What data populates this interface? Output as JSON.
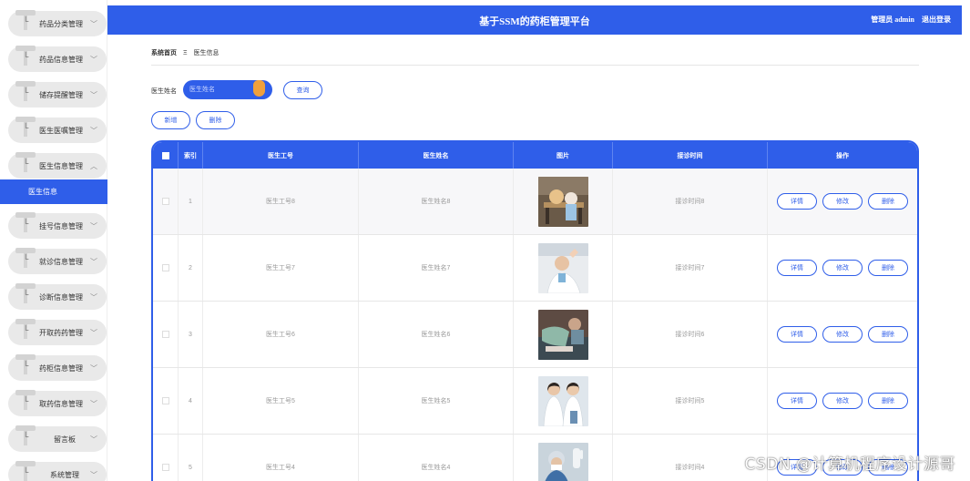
{
  "header": {
    "title": "基于SSM的药柜管理平台",
    "user_label": "管理员 admin",
    "logout": "退出登录"
  },
  "colors": {
    "primary": "#2f5ee9",
    "accent": "#f0a03c"
  },
  "sidebar": {
    "items": [
      {
        "label": "药品分类管理",
        "icon": "chevron-down-icon"
      },
      {
        "label": "药品信息管理",
        "icon": "chevron-down-icon"
      },
      {
        "label": "储存提醒管理",
        "icon": "chevron-down-icon"
      },
      {
        "label": "医生医嘱管理",
        "icon": "chevron-down-icon"
      },
      {
        "label": "医生信息管理",
        "icon": "chevron-up-icon"
      },
      {
        "label": "挂号信息管理",
        "icon": "chevron-down-icon"
      },
      {
        "label": "就诊信息管理",
        "icon": "chevron-down-icon"
      },
      {
        "label": "诊断信息管理",
        "icon": "chevron-down-icon"
      },
      {
        "label": "开取药药管理",
        "icon": "chevron-down-icon"
      },
      {
        "label": "药柜信息管理",
        "icon": "chevron-down-icon"
      },
      {
        "label": "取药信息管理",
        "icon": "chevron-down-icon"
      },
      {
        "label": "留言板",
        "icon": "chevron-down-icon"
      },
      {
        "label": "系统管理",
        "icon": "chevron-down-icon"
      }
    ],
    "active_sub": "医生信息"
  },
  "breadcrumb": {
    "home": "系统首页",
    "separator": "Ξ",
    "current": "医生信息"
  },
  "search": {
    "label": "医生姓名",
    "placeholder": "医生姓名",
    "query_button": "查询"
  },
  "actions": {
    "add": "新增",
    "delete": "删除"
  },
  "table": {
    "columns": [
      "索引",
      "医生工号",
      "医生姓名",
      "图片",
      "接诊时间",
      "操作"
    ],
    "rows": [
      {
        "index": "1",
        "id": "医生工号8",
        "name": "医生姓名8",
        "time": "接诊时间8"
      },
      {
        "index": "2",
        "id": "医生工号7",
        "name": "医生姓名7",
        "time": "接诊时间7"
      },
      {
        "index": "3",
        "id": "医生工号6",
        "name": "医生姓名6",
        "time": "接诊时间6"
      },
      {
        "index": "4",
        "id": "医生工号5",
        "name": "医生姓名5",
        "time": "接诊时间5"
      },
      {
        "index": "5",
        "id": "医生工号4",
        "name": "医生姓名4",
        "time": "接诊时间4"
      }
    ],
    "ops": {
      "detail": "详情",
      "edit": "修改",
      "delete": "删除"
    }
  },
  "watermark": "CSDN @计算机程序设计源哥"
}
